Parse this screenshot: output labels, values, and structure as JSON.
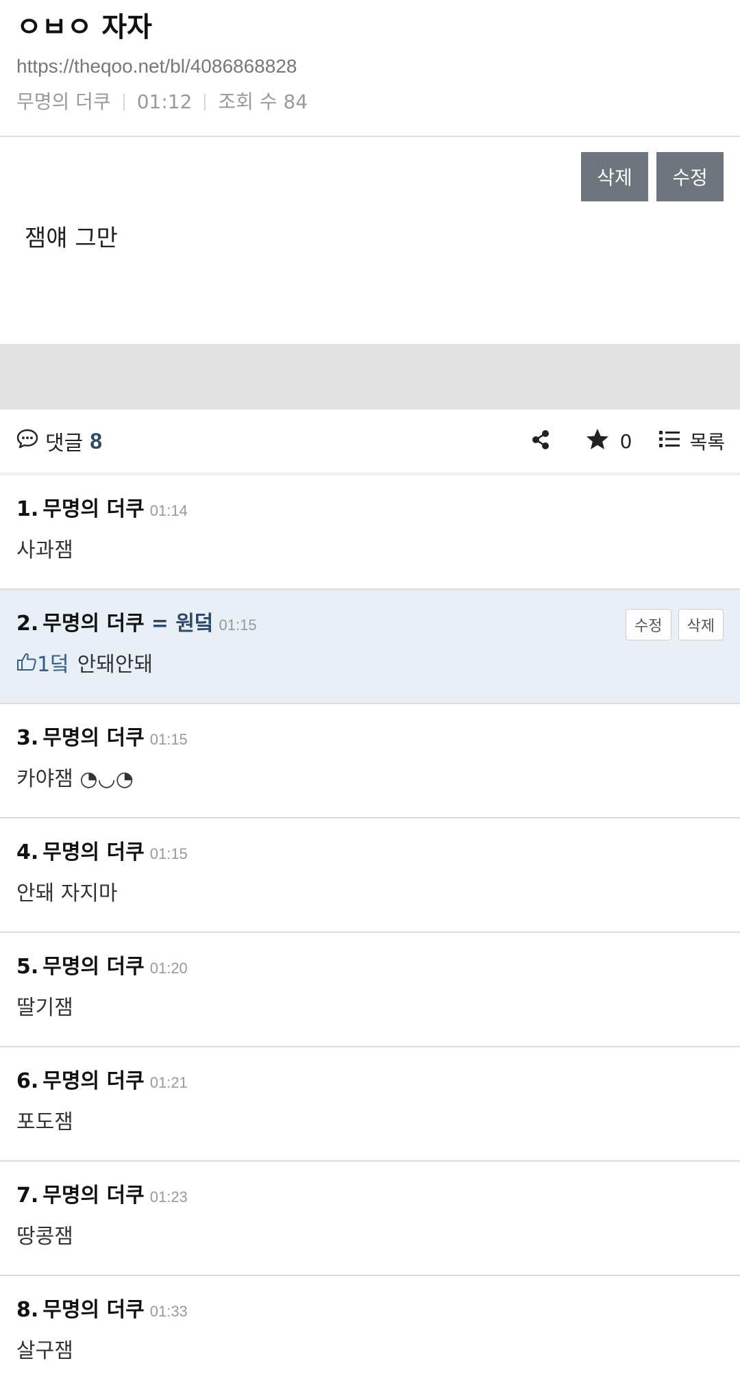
{
  "post": {
    "title": "ㅇㅂㅇ 자자",
    "url": "https://theqoo.net/bl/4086868828",
    "author": "무명의 더쿠",
    "time": "01:12",
    "views": "조회 수 84",
    "content": "잼얘 그만",
    "delete_label": "삭제",
    "edit_label": "수정"
  },
  "toolbar": {
    "comments_label": "댓글",
    "comments_count": "8",
    "star_count": "0",
    "list_label": "목록",
    "icons": [
      "comment-icon",
      "share-icon",
      "star-icon",
      "list-icon"
    ]
  },
  "comments": [
    {
      "num": "1.",
      "author": "무명의 더쿠",
      "time": "01:14",
      "text": "사과잼"
    },
    {
      "num": "2.",
      "author": "무명의 더쿠",
      "badge": "= 원덬",
      "time": "01:15",
      "likes": "1덬",
      "text": "안돼안돼",
      "edit_label": "수정",
      "delete_label": "삭제"
    },
    {
      "num": "3.",
      "author": "무명의 더쿠",
      "time": "01:15",
      "text": "카야잼 ◔◡◔"
    },
    {
      "num": "4.",
      "author": "무명의 더쿠",
      "time": "01:15",
      "text": "안돼 자지마"
    },
    {
      "num": "5.",
      "author": "무명의 더쿠",
      "time": "01:20",
      "text": "딸기잼"
    },
    {
      "num": "6.",
      "author": "무명의 더쿠",
      "time": "01:21",
      "text": "포도잼"
    },
    {
      "num": "7.",
      "author": "무명의 더쿠",
      "time": "01:23",
      "text": "땅콩잼"
    },
    {
      "num": "8.",
      "author": "무명의 더쿠",
      "time": "01:33",
      "text": "살구잼"
    }
  ],
  "colors": {
    "accent": "#2e4a6b",
    "highlight_bg": "#e8eff6",
    "button_gray": "#6e757c"
  }
}
